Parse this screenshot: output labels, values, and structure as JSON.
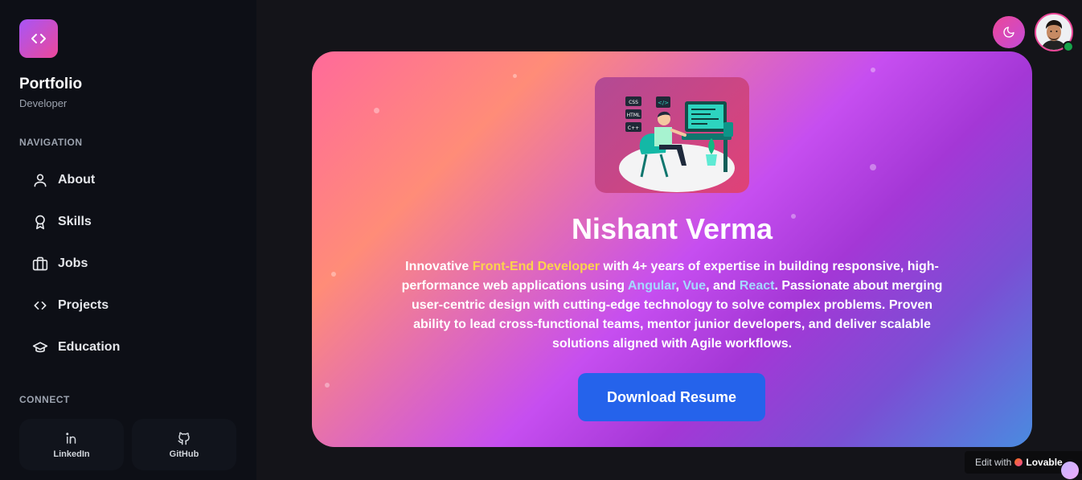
{
  "sidebar": {
    "brand_title": "Portfolio",
    "brand_subtitle": "Developer",
    "nav_heading": "NAVIGATION",
    "nav_items": [
      {
        "label": "About",
        "icon": "user-icon"
      },
      {
        "label": "Skills",
        "icon": "award-icon"
      },
      {
        "label": "Jobs",
        "icon": "briefcase-icon"
      },
      {
        "label": "Projects",
        "icon": "code-icon"
      },
      {
        "label": "Education",
        "icon": "graduation-cap-icon"
      }
    ],
    "connect_heading": "CONNECT",
    "social": [
      {
        "label": "LinkedIn",
        "icon": "linkedin-icon"
      },
      {
        "label": "GitHub",
        "icon": "github-icon"
      }
    ]
  },
  "header": {
    "theme_toggle_icon": "moon-icon",
    "avatar_icon": "profile-avatar"
  },
  "hero": {
    "name": "Nishant Verma",
    "bio": {
      "p1": "Innovative ",
      "role": "Front-End Developer",
      "p2": " with 4+ years of expertise in building responsive, high-performance web applications using ",
      "tech1": "Angular",
      "sep1": ", ",
      "tech2": "Vue",
      "sep2": ", and ",
      "tech3": "React",
      "p3": ". Passionate about merging user-centric design with cutting-edge technology to solve complex problems. Proven ability to lead cross-functional teams, mentor junior developers, and deliver scalable solutions aligned with Agile workflows."
    },
    "illustration_tags": [
      "CSS",
      "HTML",
      "C++"
    ],
    "download_label": "Download Resume"
  },
  "badge": {
    "edit_with": "Edit with",
    "brand": "Lovable"
  },
  "colors": {
    "accent_pink": "#ec4899",
    "button_blue": "#2563eb",
    "highlight_yellow": "#fcd34d",
    "highlight_blue": "#a5d8ff",
    "sidebar_bg": "#0d0f16",
    "page_bg": "#141419"
  }
}
